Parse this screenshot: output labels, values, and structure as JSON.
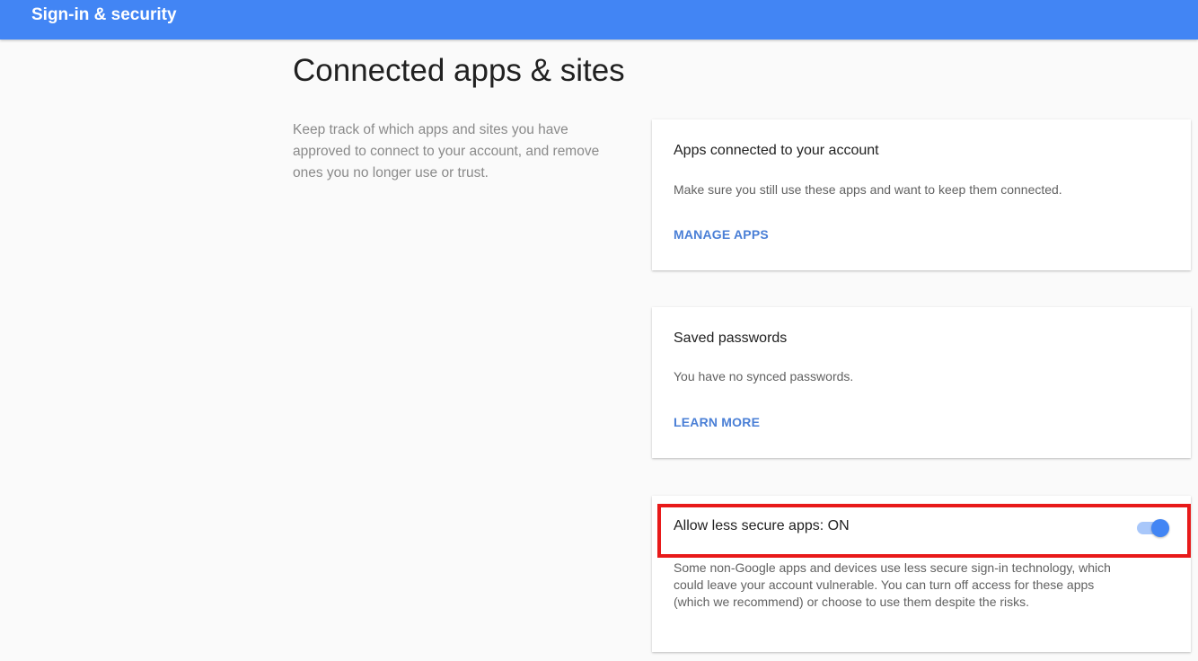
{
  "header": {
    "title": "Sign-in & security",
    "color": "#4285f4"
  },
  "page": {
    "title": "Connected apps & sites",
    "intro": "Keep track of which apps and sites you have approved to connect to your account, and remove ones you no longer use or trust."
  },
  "cards": [
    {
      "title": "Apps connected to your account",
      "description": "Make sure you still use these apps and want to keep them connected.",
      "link": "MANAGE APPS"
    },
    {
      "title": "Saved passwords",
      "description": "You have no synced passwords.",
      "link": "LEARN MORE"
    },
    {
      "title": "Allow less secure apps: ON",
      "description_lines": [
        "Some non-Google apps and devices use less secure sign-in technology, which",
        "could leave your account vulnerable. You can turn off access for these apps",
        "(which we recommend) or choose to use them despite the risks."
      ],
      "toggle_on": true
    }
  ],
  "colors": {
    "accent": "#4285f4",
    "link": "#4a7fd6",
    "highlight": "#e81a1a"
  }
}
